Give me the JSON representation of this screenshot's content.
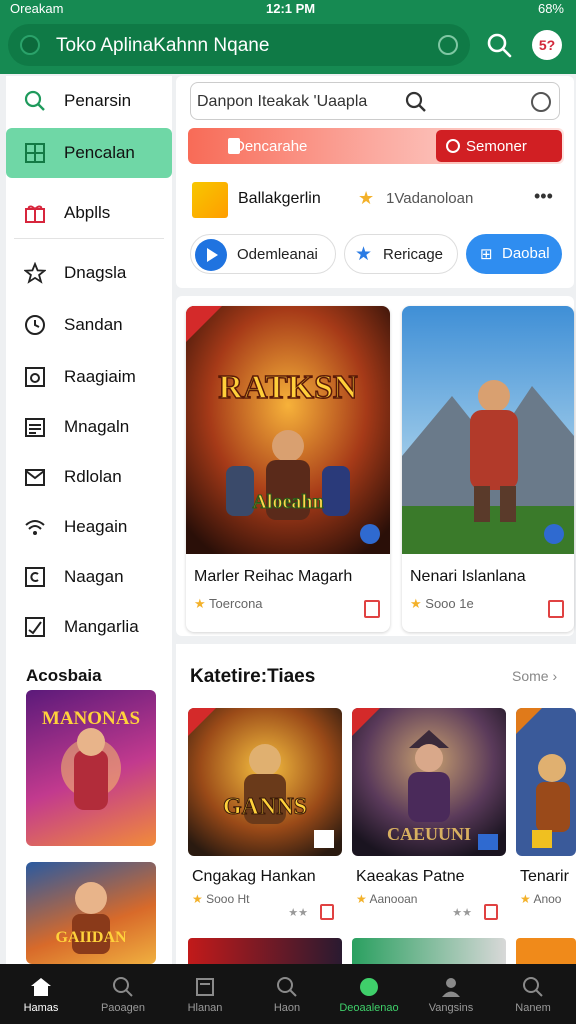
{
  "status": {
    "carrier": "Oreakam",
    "time": "12:1 PM",
    "battery": "68%"
  },
  "header": {
    "title": "Toko AplinaKahnn Nqane",
    "avatar_text": "5?"
  },
  "search": {
    "value": "Danpon Iteakak 'Uaapla"
  },
  "sidebar": {
    "items": [
      {
        "label": "Penarsin",
        "icon": "search-icon"
      },
      {
        "label": "Pencalan",
        "icon": "grid-icon",
        "active": true
      },
      {
        "label": "Abplls",
        "icon": "gift-icon"
      },
      {
        "label": "Dnagsla",
        "icon": "star-icon"
      },
      {
        "label": "Sandan",
        "icon": "clock-icon"
      },
      {
        "label": "Raagiaim",
        "icon": "photo-icon"
      },
      {
        "label": "Mnagaln",
        "icon": "calendar-icon"
      },
      {
        "label": "Rdlolan",
        "icon": "mail-icon"
      },
      {
        "label": "Heagain",
        "icon": "wifi-icon"
      },
      {
        "label": "Naagan",
        "icon": "c-box-icon"
      },
      {
        "label": "Mangarlia",
        "icon": "check-icon"
      }
    ],
    "section_title": "Acosbaia",
    "thumbs": [
      "MANONAS",
      "GAIIDAN"
    ]
  },
  "banner": {
    "label": "Dencarahe",
    "button": "Semoner"
  },
  "promo": {
    "name": "Ballakgerlin",
    "sub": "1Vadanoloan",
    "more": "•••"
  },
  "chips": [
    {
      "label": "Odemleanai"
    },
    {
      "label": "Rericage"
    },
    {
      "label": "Daobal"
    }
  ],
  "featured": [
    {
      "name": "Marler Reihac Magarh",
      "rating": "Toercona",
      "art_text": "RATKSN",
      "art_sub": "Aloeahn"
    },
    {
      "name": "Nenari Islanlana",
      "rating": "Sooo 1e"
    }
  ],
  "category": {
    "title": "Katetire:Tiaes",
    "more": "Some",
    "items": [
      {
        "name": "Cngakag Hankan",
        "sub": "Sooo Ht",
        "art_text": "GANNS"
      },
      {
        "name": "Kaeakas Patne",
        "sub": "Aanooan",
        "art_text": "CAEUUNI"
      },
      {
        "name": "Tenarir",
        "sub": "Anoo"
      }
    ]
  },
  "bottom_nav": [
    {
      "label": "Hamas",
      "icon": "home-icon",
      "state": "on"
    },
    {
      "label": "Paoagen",
      "icon": "search-icon"
    },
    {
      "label": "Hlanan",
      "icon": "list-icon"
    },
    {
      "label": "Haon",
      "icon": "search-icon"
    },
    {
      "label": "Deoaalenao",
      "icon": "dot-icon",
      "state": "green"
    },
    {
      "label": "Vangsins",
      "icon": "person-icon"
    },
    {
      "label": "Nanem",
      "icon": "search-icon"
    }
  ],
  "colors": {
    "brand": "#168a52",
    "accent": "#2f8df0",
    "danger": "#d11f23",
    "active_side": "#6fd7a6"
  }
}
